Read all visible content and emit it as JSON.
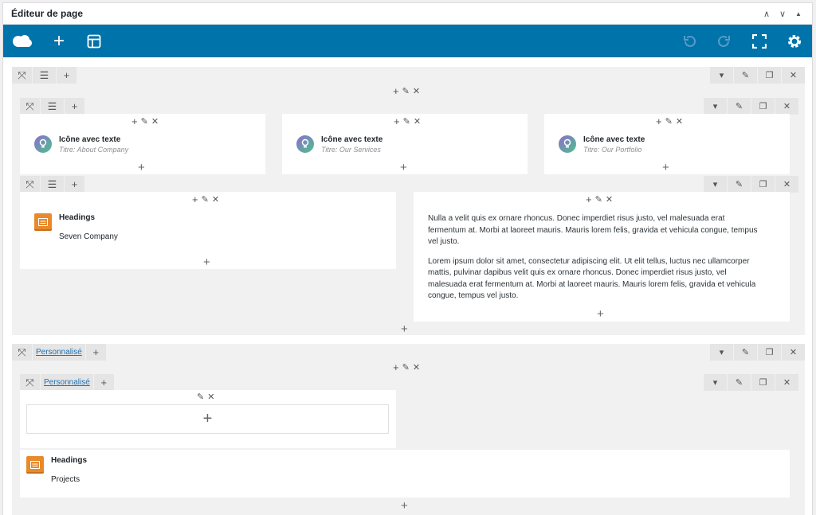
{
  "panel": {
    "title": "Éditeur de page",
    "ctrl_up": "∧",
    "ctrl_down": "∨",
    "ctrl_toggle": "▲"
  },
  "toolbar": {
    "add_label": "+",
    "colors": {
      "bg": "#0073aa",
      "icon": "#ffffff",
      "dim": "#5b9bc6"
    }
  },
  "icons": {
    "expand": "⤧",
    "lines": "☰",
    "plus": "+",
    "pencil": "✎",
    "close": "✕",
    "caret": "▾",
    "copy": "❐"
  },
  "row1": {
    "modules": [
      {
        "title": "Icône avec texte",
        "subtitle": "Titre: About Company"
      },
      {
        "title": "Icône avec texte",
        "subtitle": "Titre: Our Services"
      },
      {
        "title": "Icône avec texte",
        "subtitle": "Titre: Our Portfolio"
      }
    ],
    "heading": {
      "title": "Headings",
      "text": "Seven Company"
    },
    "paragraphs": [
      "Nulla a velit quis ex ornare rhoncus. Donec imperdiet risus justo, vel malesuada erat fermentum at. Morbi at laoreet mauris. Mauris lorem felis, gravida et vehicula congue, tempus vel justo.",
      "Lorem ipsum dolor sit amet, consectetur adipiscing elit. Ut elit tellus, luctus nec ullamcorper mattis, pulvinar dapibus velit quis ex ornare rhoncus. Donec imperdiet risus justo, vel malesuada erat fermentum at. Morbi at laoreet mauris. Mauris lorem felis, gravida et vehicula congue, tempus vel justo."
    ]
  },
  "row2": {
    "label": "Personnalisé",
    "inner_label": "Personnalisé",
    "heading": {
      "title": "Headings",
      "text": "Projects"
    }
  }
}
